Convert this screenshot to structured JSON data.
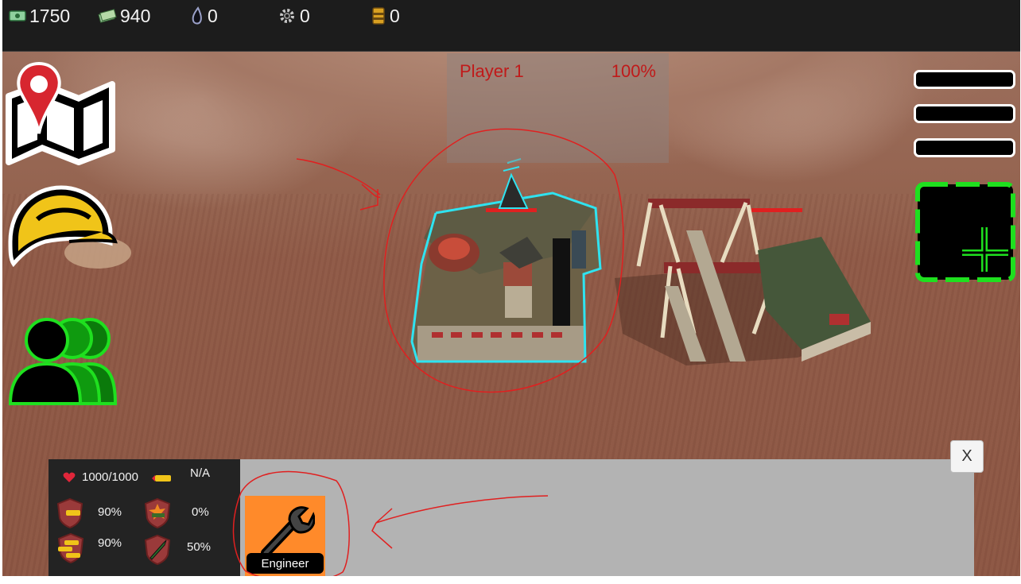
{
  "resources": [
    {
      "icon": "money-icon",
      "value": "1750"
    },
    {
      "icon": "cash-stack-icon",
      "value": "940"
    },
    {
      "icon": "oil-drop-icon",
      "value": "0"
    },
    {
      "icon": "gear-icon",
      "value": "0"
    },
    {
      "icon": "barrel-icon",
      "value": "0"
    }
  ],
  "player_panel": {
    "name": "Player 1",
    "percent": "100%"
  },
  "left_buttons": [
    "map-button",
    "builder-hardhat-button",
    "units-group-button"
  ],
  "right_buttons": [
    "menu-bar-1",
    "menu-bar-2",
    "menu-bar-3",
    "select-add-button"
  ],
  "selected_unit": {
    "health": "1000/1000",
    "ammo": "N/A",
    "armor_rows": [
      {
        "left_value": "90%",
        "right_value": "0%"
      },
      {
        "left_value": "90%",
        "right_value": "50%"
      }
    ]
  },
  "commands": [
    {
      "label": "Engineer",
      "icon": "wrench-icon"
    }
  ],
  "close_label": "X",
  "colors": {
    "selection": "#2fe3f0",
    "annotation": "#e02020",
    "accent_green": "#1fe01f",
    "command_orange": "#ff8a2a"
  }
}
